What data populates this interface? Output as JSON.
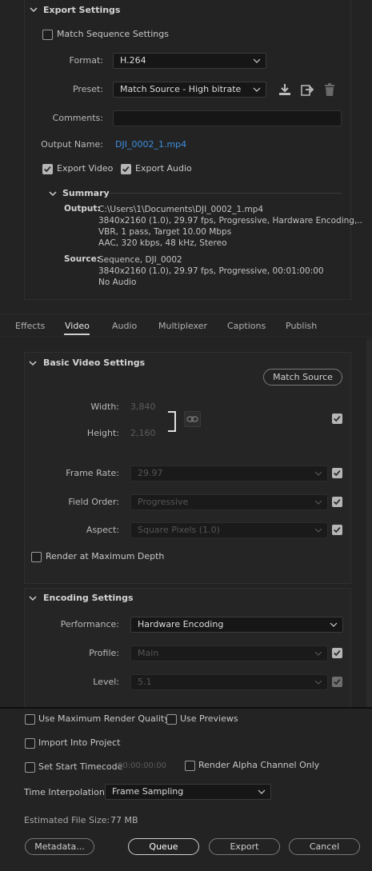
{
  "export_settings": {
    "section_title": "Export Settings",
    "match_sequence_label": "Match Sequence Settings",
    "format_label": "Format:",
    "format_value": "H.264",
    "preset_label": "Preset:",
    "preset_value": "Match Source - High bitrate",
    "comments_label": "Comments:",
    "comments_value": "",
    "output_name_label": "Output Name:",
    "output_name_value": "DJI_0002_1.mp4",
    "export_video_label": "Export Video",
    "export_audio_label": "Export Audio"
  },
  "summary": {
    "title": "Summary",
    "output_label": "Output:",
    "output_lines": [
      "C:\\Users\\1\\Documents\\DJI_0002_1.mp4",
      "3840x2160 (1.0), 29.97 fps, Progressive, Hardware Encoding,..",
      "VBR, 1 pass, Target 10.00 Mbps",
      "AAC, 320 kbps, 48 kHz, Stereo"
    ],
    "source_label": "Source:",
    "source_lines": [
      "Sequence, DJI_0002",
      "3840x2160 (1.0), 29.97 fps, Progressive, 00:01:00:00",
      "No Audio"
    ]
  },
  "tabs": [
    {
      "label": "Effects"
    },
    {
      "label": "Video"
    },
    {
      "label": "Audio"
    },
    {
      "label": "Multiplexer"
    },
    {
      "label": "Captions"
    },
    {
      "label": "Publish"
    }
  ],
  "basic_video": {
    "title": "Basic Video Settings",
    "match_source_label": "Match Source",
    "width_label": "Width:",
    "width_value": "3,840",
    "height_label": "Height:",
    "height_value": "2,160",
    "frame_rate_label": "Frame Rate:",
    "frame_rate_value": "29.97",
    "field_order_label": "Field Order:",
    "field_order_value": "Progressive",
    "aspect_label": "Aspect:",
    "aspect_value": "Square Pixels (1.0)",
    "render_max_depth_label": "Render at Maximum Depth"
  },
  "encoding": {
    "title": "Encoding Settings",
    "performance_label": "Performance:",
    "performance_value": "Hardware Encoding",
    "profile_label": "Profile:",
    "profile_value": "Main",
    "level_label": "Level:",
    "level_value": "5.1"
  },
  "bottom": {
    "use_max_render_label": "Use Maximum Render Quality",
    "use_previews_label": "Use Previews",
    "import_project_label": "Import Into Project",
    "set_start_timecode_label": "Set Start Timecode",
    "start_timecode_value": "00:00:00:00",
    "render_alpha_label": "Render Alpha Channel Only",
    "time_interp_label": "Time Interpolation:",
    "time_interp_value": "Frame Sampling",
    "est_size_label": "Estimated File Size:",
    "est_size_value": "77 MB",
    "metadata_label": "Metadata...",
    "queue_label": "Queue",
    "export_label": "Export",
    "cancel_label": "Cancel"
  }
}
